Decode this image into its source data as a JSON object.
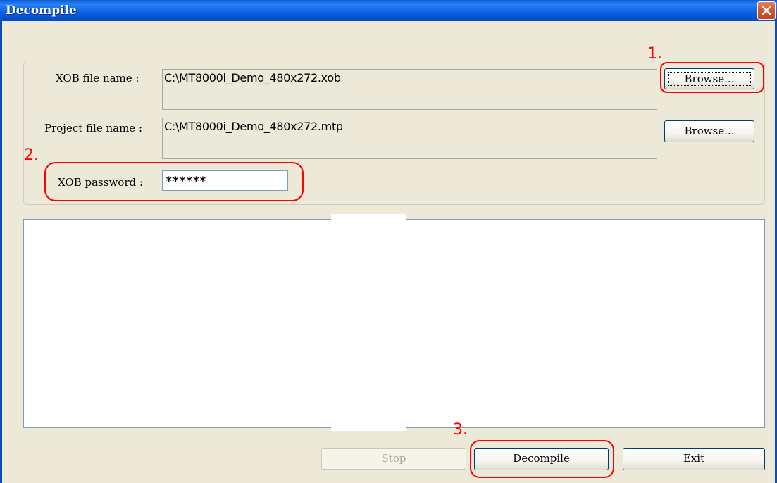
{
  "window": {
    "title": "Decompile"
  },
  "form": {
    "xob_label": "XOB file name :",
    "xob_value": "C:\\MT8000i_Demo_480x272.xob",
    "project_label": "Project file name :",
    "project_value": "C:\\MT8000i_Demo_480x272.mtp",
    "password_label": "XOB password :",
    "password_value": "******",
    "browse_label": "Browse..."
  },
  "log": {
    "content": ""
  },
  "buttons": {
    "stop": "Stop",
    "decompile": "Decompile",
    "exit": "Exit"
  },
  "annotations": {
    "step1": "1.",
    "step2": "2.",
    "step3": "3."
  },
  "colors": {
    "annotation": "#FF0000",
    "titlebar": "#0A5BD9",
    "close": "#D45A30",
    "dialog_bg": "#ECE9D8"
  },
  "icons": {
    "close": "close-icon"
  }
}
